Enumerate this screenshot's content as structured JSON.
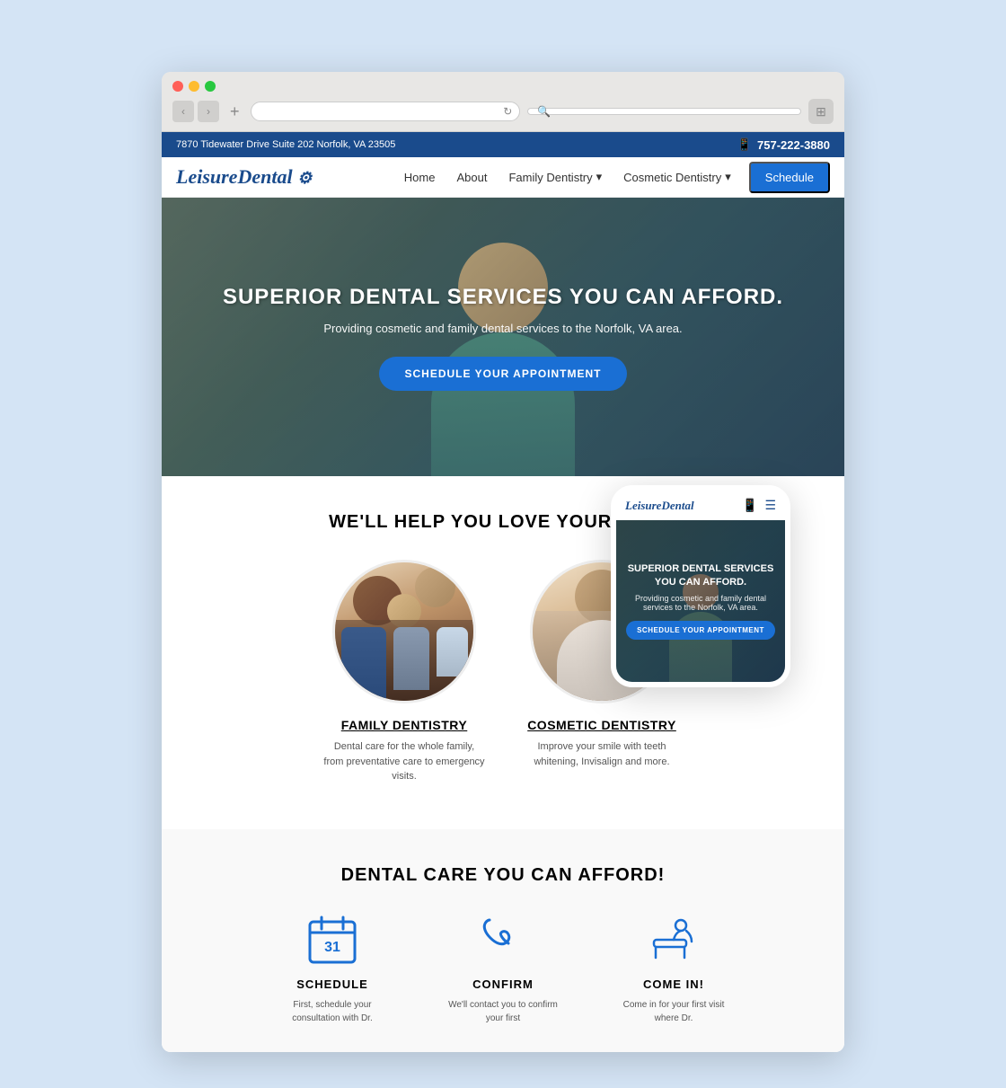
{
  "browser": {
    "url": "",
    "search_placeholder": ""
  },
  "site": {
    "name": "LeisureDental",
    "logo_symbol": "🦷",
    "top_bar": {
      "address": "7870 Tidewater Drive Suite 202 Norfolk, VA 23505",
      "phone": "757-222-3880"
    },
    "nav": {
      "links": [
        {
          "label": "Home",
          "has_dropdown": false
        },
        {
          "label": "About",
          "has_dropdown": false
        },
        {
          "label": "Family Dentistry",
          "has_dropdown": true
        },
        {
          "label": "Cosmetic Dentistry",
          "has_dropdown": true
        }
      ],
      "cta_label": "Schedule"
    },
    "hero": {
      "title": "SUPERIOR DENTAL SERVICES YOU CAN AFFORD.",
      "subtitle": "Providing cosmetic and family dental services to the Norfolk, VA area.",
      "cta_label": "SCHEDULE YOUR APPOINTMENT"
    },
    "services": {
      "section_title": "WE'LL HELP YOU LOVE YOUR SMILE",
      "items": [
        {
          "name": "FAMILY DENTISTRY",
          "description": "Dental care for the whole family, from preventative care to emergency visits."
        },
        {
          "name": "COSMETIC DENTISTRY",
          "description": "Improve your smile with teeth whitening, Invisalign and more."
        }
      ]
    },
    "afford": {
      "section_title": "DENTAL CARE YOU CAN AFFORD!",
      "steps": [
        {
          "icon": "calendar",
          "name": "SCHEDULE",
          "description": "First, schedule your consultation with Dr."
        },
        {
          "icon": "phone",
          "name": "CONFIRM",
          "description": "We'll contact you to confirm your first"
        },
        {
          "icon": "dental-chair",
          "name": "COME IN!",
          "description": "Come in for your first visit where Dr."
        }
      ]
    }
  },
  "mobile": {
    "logo": "LeisureDental",
    "hero": {
      "title": "SUPERIOR DENTAL SERVICES YOU CAN AFFORD.",
      "subtitle": "Providing cosmetic and family dental services to the Norfolk, VA area.",
      "cta_label": "SCHEDULE YOUR APPOINTMENT"
    }
  }
}
